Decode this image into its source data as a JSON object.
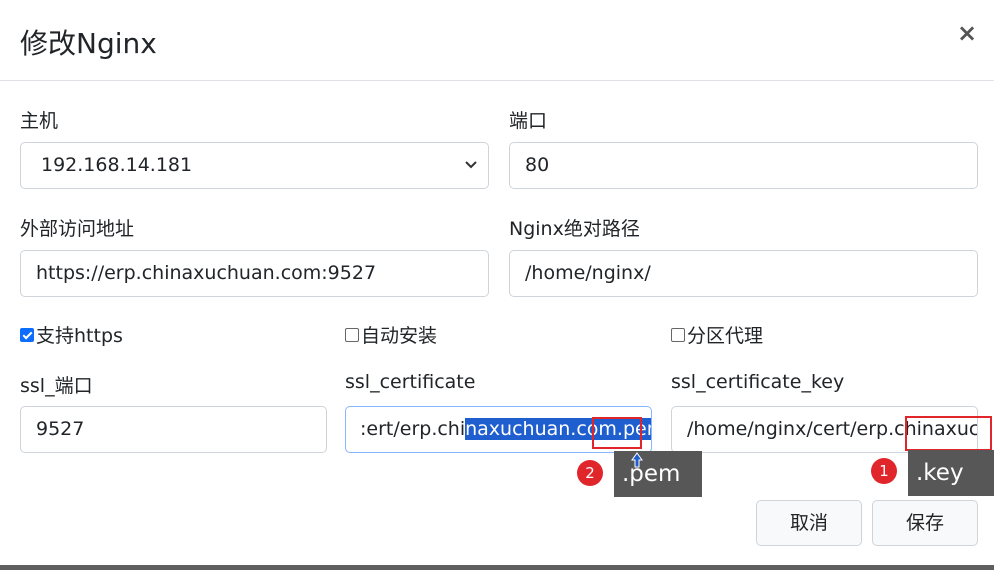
{
  "dialog": {
    "title": "修改Nginx",
    "close_glyph": "×"
  },
  "fields": {
    "host": {
      "label": "主机",
      "value": "192.168.14.181"
    },
    "port": {
      "label": "端口",
      "value": "80"
    },
    "external_url": {
      "label": "外部访问地址",
      "value": "https://erp.chinaxuchuan.com:9527"
    },
    "nginx_path": {
      "label": "Nginx绝对路径",
      "value": "/home/nginx/"
    },
    "ssl_port": {
      "label": "ssl_端口",
      "value": "9527"
    },
    "ssl_certificate": {
      "label": "ssl_certificate",
      "value_before": ":ert/erp.chi",
      "value_selected": "naxuchuan.com.pem"
    },
    "ssl_certificate_key": {
      "label": "ssl_certificate_key",
      "value": "/home/nginx/cert/erp.chinaxuc"
    }
  },
  "checkboxes": {
    "https": {
      "label": "支持https",
      "checked": true
    },
    "auto_install": {
      "label": "自动安装",
      "checked": false
    },
    "partition_proxy": {
      "label": "分区代理",
      "checked": false
    }
  },
  "annotations": {
    "badge_1": "1",
    "badge_2": "2",
    "tip_1": ".key",
    "tip_2": ".pem"
  },
  "buttons": {
    "cancel": "取消",
    "save": "保存"
  },
  "colors": {
    "selection": "#1e5ecf",
    "annotation_red": "#e0262b",
    "tooltip_bg": "#575757",
    "checkbox_on": "#0d6efd"
  }
}
